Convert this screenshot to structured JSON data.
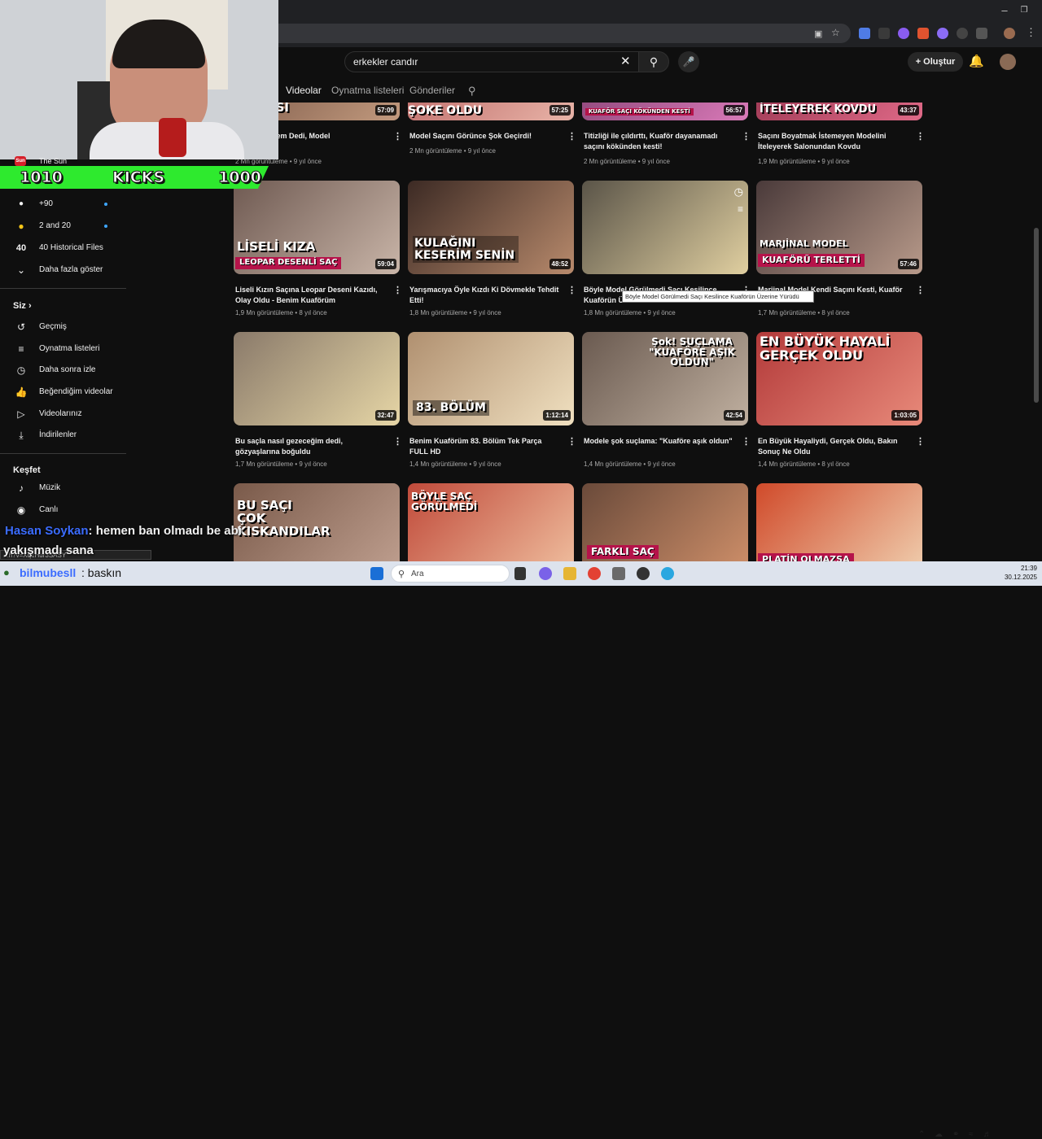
{
  "browser": {
    "address_text": ""
  },
  "youtube": {
    "search_value": "erkekler candır",
    "create_label": "Oluştur",
    "tabs": [
      "Videolar",
      "Oynatma listeleri",
      "Gönderiler"
    ]
  },
  "sidebar": {
    "top_items": [
      {
        "label": "The Sun"
      },
      {
        "label": "+90",
        "dot": true
      },
      {
        "label": "2 and 20",
        "dot": true
      },
      {
        "label": "40 Historical Files"
      },
      {
        "label": "Daha fazla göster"
      }
    ],
    "you_header": "Siz",
    "you_items": [
      "Geçmiş",
      "Oynatma listeleri",
      "Daha sonra izle",
      "Beğendiğim videolar",
      "Videolarınız",
      "İndirilenler"
    ],
    "explore_header": "Keşfet",
    "explore_items": [
      "Müzik",
      "Canlı"
    ],
    "icons": {
      "the_sun": "the-sun-logo",
      "plus90": "+90-logo",
      "two_and_20": "2-and-20-logo",
      "historical": "40-logo"
    }
  },
  "videos": [
    {
      "thumb_text": "ASI",
      "duration": "57:09",
      "title": "...ön Çekemem Dedi, Model",
      "views": "2 Mn görüntüleme",
      "age": "9 yıl önce"
    },
    {
      "thumb_text": "ŞOKE OLDU",
      "duration": "57:25",
      "title": "Model Saçını Görünce Şok Geçirdi!",
      "views": "2 Mn görüntüleme",
      "age": "9 yıl önce"
    },
    {
      "thumb_text": "KUAFÖR SAÇI KÖKÜNDEN KESTİ",
      "duration": "56:57",
      "title": "Titizliği ile çıldırttı, Kuaför dayanamadı saçını kökünden kesti!",
      "views": "2 Mn görüntüleme",
      "age": "9 yıl önce"
    },
    {
      "thumb_text": "İTELEYEREK KOVDU",
      "duration": "43:37",
      "title": "Saçını Boyatmak İstemeyen Modelini İteleyerek Salonundan Kovdu",
      "views": "1,9 Mn görüntüleme",
      "age": "9 yıl önce"
    },
    {
      "thumb_text": "LİSELİ KIZA",
      "thumb_text2": "LEOPAR DESENLİ SAÇ",
      "duration": "59:04",
      "title": "Liseli Kızın Saçına Leopar Deseni Kazıdı, Olay Oldu - Benim Kuaförüm",
      "views": "1,9 Mn görüntüleme",
      "age": "8 yıl önce"
    },
    {
      "thumb_text": "KULAĞINI KESERİM SENİN",
      "duration": "48:52",
      "title": "Yarışmacıya Öyle Kızdı Ki Dövmekle Tehdit Etti!",
      "views": "1,8 Mn görüntüleme",
      "age": "9 yıl önce"
    },
    {
      "thumb_text": "",
      "duration": "",
      "title": "Böyle Model Görülmedi Saçı Kesilince Kuaförün Üz...",
      "views": "1,8 Mn görüntüleme",
      "age": "9 yıl önce"
    },
    {
      "thumb_text": "MARJİNAL MODEL",
      "thumb_text2": "KUAFÖRÜ TERLETTİ",
      "duration": "57:46",
      "title": "Marjinal Model Kendi Saçını Kesti, Kuaför",
      "views": "1,7 Mn görüntüleme",
      "age": "8 yıl önce"
    },
    {
      "thumb_text": "",
      "duration": "32:47",
      "title": "Bu saçla nasıl gezeceğim dedi, gözyaşlarına boğuldu",
      "views": "1,7 Mn görüntüleme",
      "age": "9 yıl önce"
    },
    {
      "thumb_text": "83. BÖLÜM",
      "duration": "1:12:14",
      "title": "Benim Kuaförüm 83. Bölüm Tek Parça FULL HD",
      "views": "1,4 Mn görüntüleme",
      "age": "9 yıl önce"
    },
    {
      "thumb_text": "Şok! SUÇLAMA \"KUAFÖRE AŞIK OLDUN\"",
      "duration": "42:54",
      "title": "Modele şok suçlama: \"Kuaföre aşık oldun\"",
      "views": "1,4 Mn görüntüleme",
      "age": "9 yıl önce"
    },
    {
      "thumb_text": "EN BÜYÜK HAYALİ GERÇEK OLDU",
      "duration": "1:03:05",
      "title": "En Büyük Hayaliydi, Gerçek Oldu, Bakın Sonuç Ne Oldu",
      "views": "1,4 Mn görüntüleme",
      "age": "8 yıl önce"
    },
    {
      "thumb_text": "BU SAÇI ÇOK KISKANDILAR",
      "duration": "",
      "title": "",
      "views": "",
      "age": ""
    },
    {
      "thumb_text": "BÖYLE SAÇ GÖRÜLMEDİ",
      "duration": "",
      "title": "",
      "views": "",
      "age": ""
    },
    {
      "thumb_text": "FARKLI SAÇ",
      "duration": "",
      "title": "",
      "views": "",
      "age": ""
    },
    {
      "thumb_text": "PLATİN OLMAZSA",
      "duration": "",
      "title": "",
      "views": "",
      "age": ""
    }
  ],
  "tooltip": "Böyle Model Görülmedi Saçı Kesilince Kuaförün Üzerine Yürüdü",
  "stream_overlay": {
    "kicks_left": "1010",
    "kicks_label": "KICKS",
    "kicks_right": "1000",
    "chat1_user": "Hasan Soykan",
    "chat1_msg": ": hemen ban olmadı be abi",
    "chat2_line": "yakışmadı sana",
    "chat3_user": "bilmubesll",
    "chat3_msg": ": baskın",
    "url_hint": "...h?v=Xq1Hur3SASY"
  },
  "taskbar": {
    "search_placeholder": "Ara",
    "time": "21:39",
    "date": "30.12.2025"
  },
  "colors": {
    "yt_bg": "#0f0f0f",
    "kicks_green": "#2eea2e",
    "chat_user": "#3b6cff",
    "accent_blue": "#3ea6ff"
  }
}
